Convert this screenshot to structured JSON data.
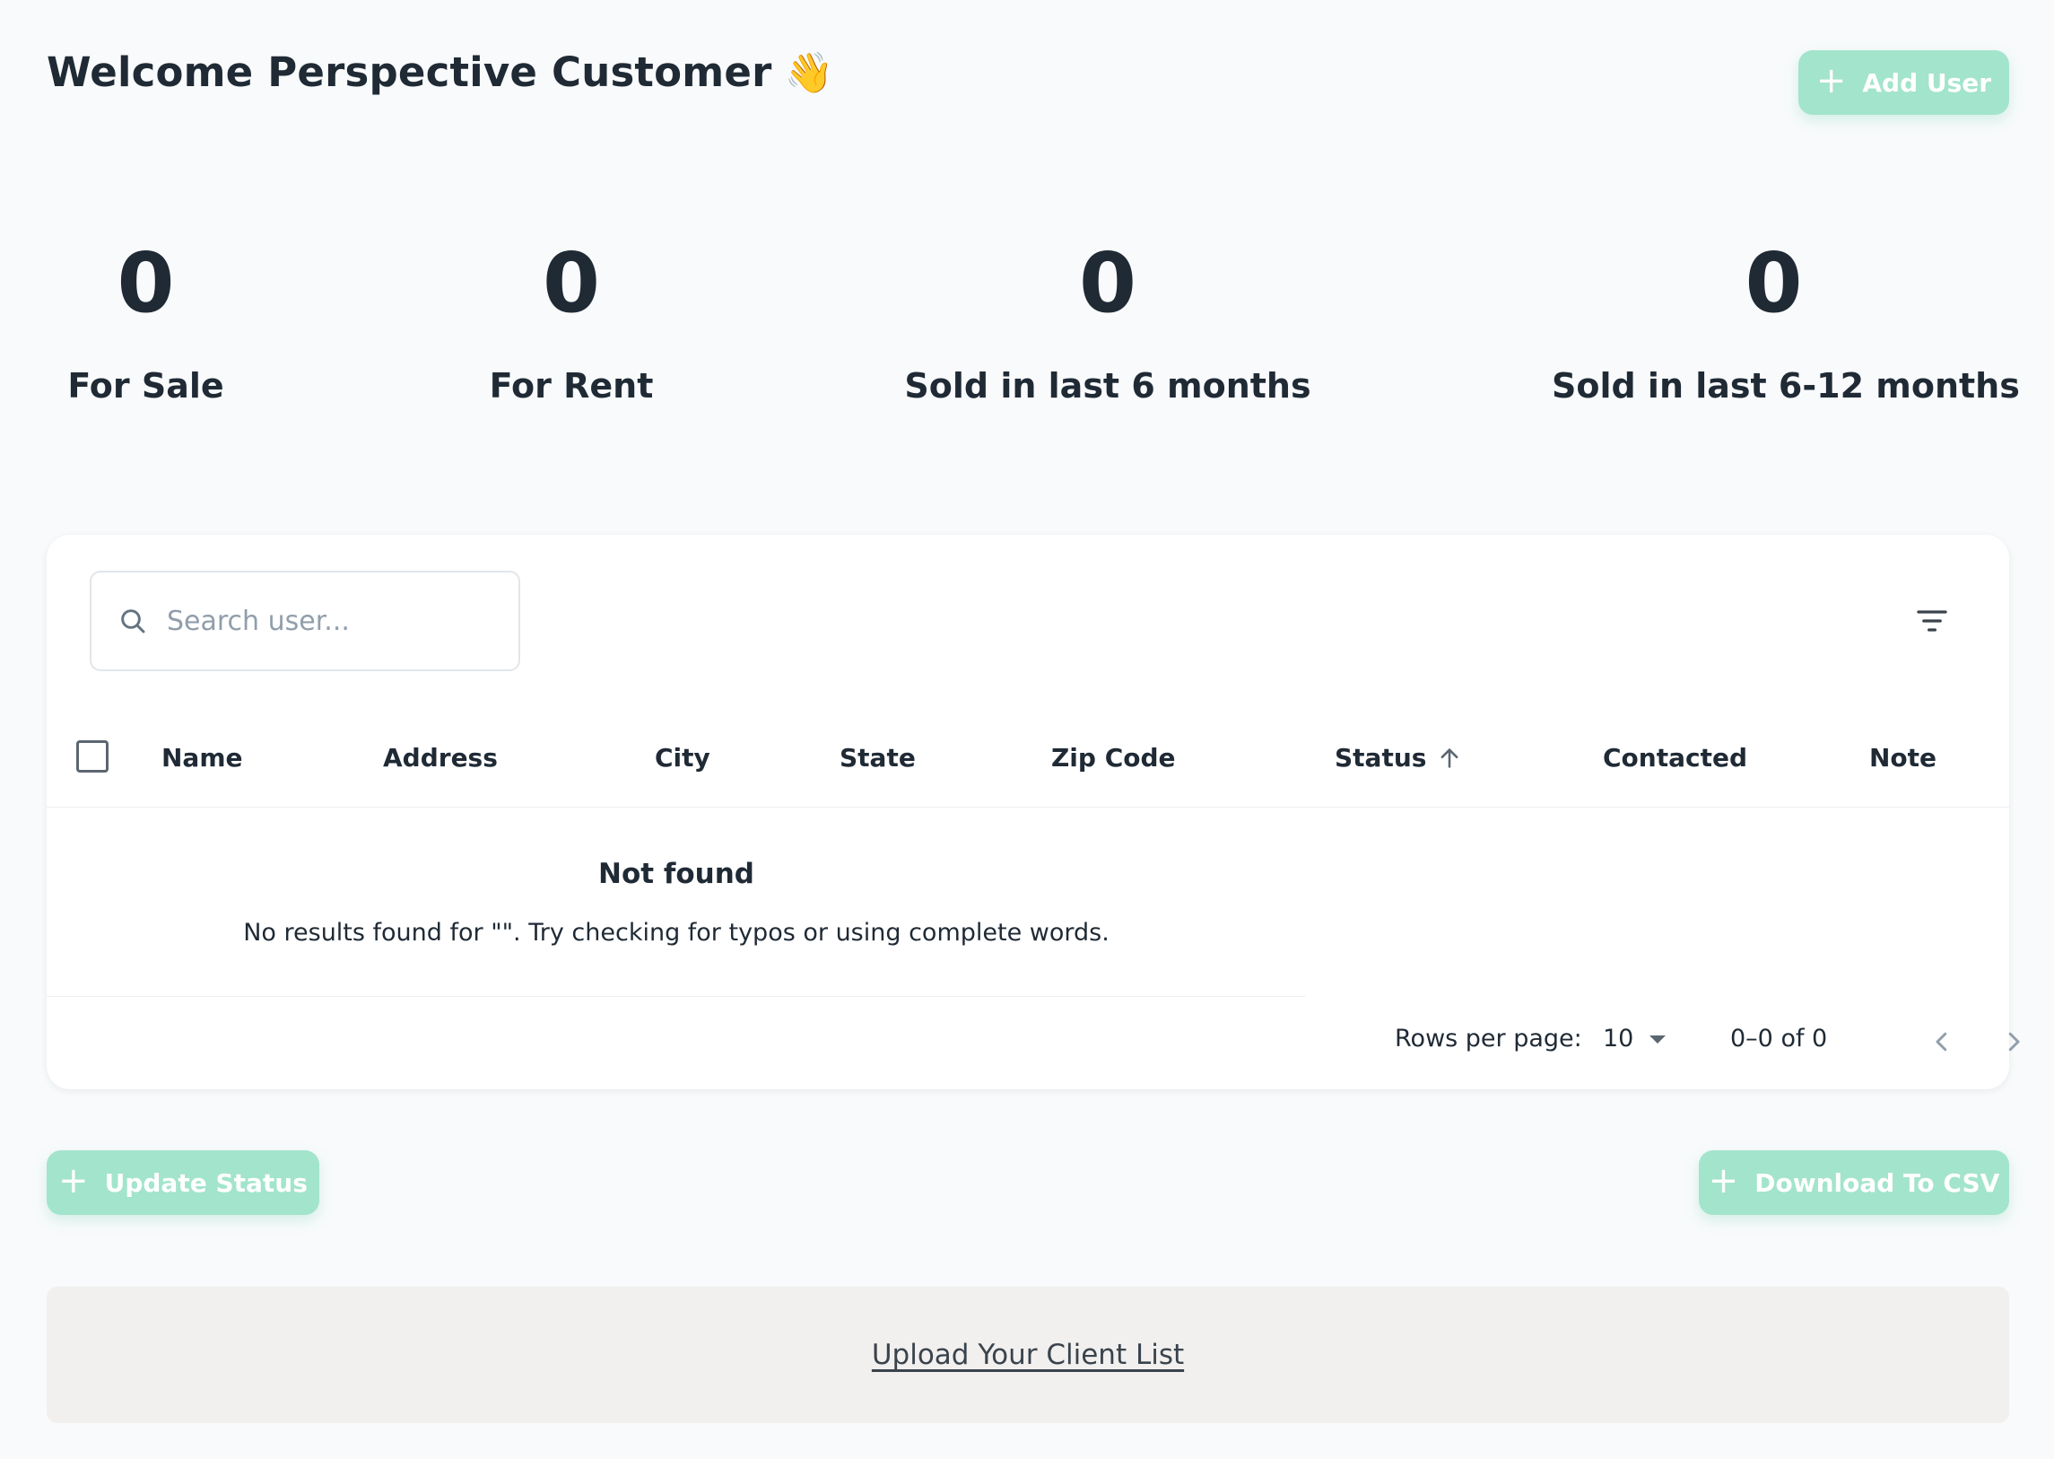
{
  "header": {
    "title": "Welcome Perspective Customer",
    "title_emoji": "👋",
    "add_user_label": "Add User"
  },
  "stats": [
    {
      "value": "0",
      "label": "For Sale"
    },
    {
      "value": "0",
      "label": "For Rent"
    },
    {
      "value": "0",
      "label": "Sold in last 6 months"
    },
    {
      "value": "0",
      "label": "Sold in last 6-12 months"
    }
  ],
  "table": {
    "search_placeholder": "Search user...",
    "search_value": "",
    "columns": [
      "Name",
      "Address",
      "City",
      "State",
      "Zip Code",
      "Status",
      "Contacted",
      "Note"
    ],
    "sorted_column": "Status",
    "sort_direction": "ascending",
    "empty": {
      "title": "Not found",
      "description": "No results found for  \"\". Try checking for typos or using complete words."
    },
    "pagination": {
      "rows_per_page_label": "Rows per page:",
      "rows_per_page": "10",
      "range": "0–0 of 0"
    }
  },
  "actions": {
    "update_status_label": "Update Status",
    "download_csv_label": "Download To CSV"
  },
  "upload": {
    "link_label": "Upload Your Client List"
  },
  "icons": {
    "search": "search-icon",
    "filter": "filter-list-icon",
    "sort": "arrow-up-icon",
    "plus": "plus-icon",
    "dropdown": "caret-down-icon",
    "prev": "chevron-left-icon",
    "next": "chevron-right-icon"
  },
  "colors": {
    "accent_button": "#a3e4cc",
    "text_primary": "#1f2a35",
    "page_background": "#f8fafb",
    "upload_background": "#f1f0ee"
  }
}
